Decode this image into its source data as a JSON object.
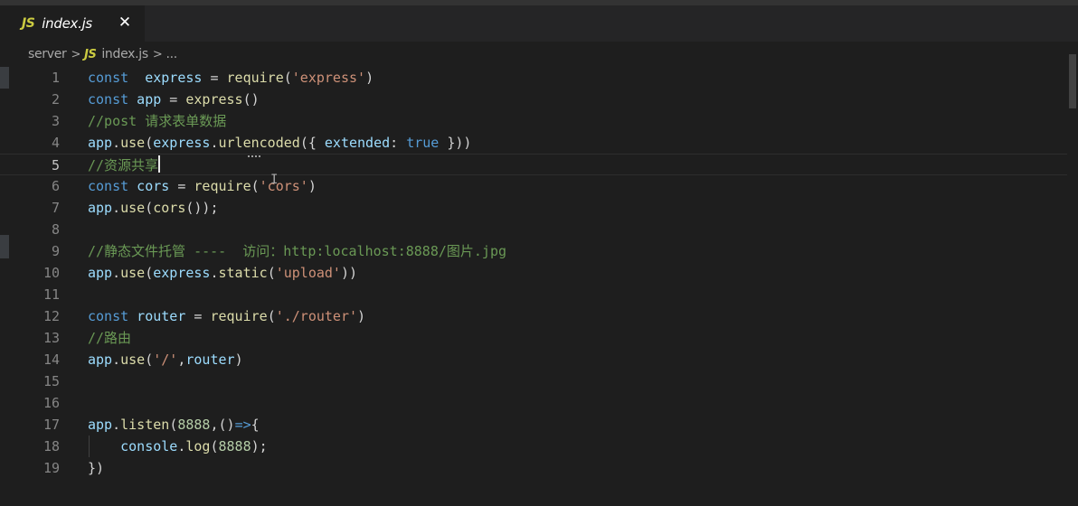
{
  "tab": {
    "language_badge": "JS",
    "filename": "index.js",
    "close_glyph": "✕"
  },
  "breadcrumb": {
    "folder": "server",
    "language_badge": "JS",
    "file": "index.js",
    "more": "..."
  },
  "editor": {
    "current_line": 5,
    "lines": [
      {
        "n": "1"
      },
      {
        "n": "2"
      },
      {
        "n": "3"
      },
      {
        "n": "4"
      },
      {
        "n": "5"
      },
      {
        "n": "6"
      },
      {
        "n": "7"
      },
      {
        "n": "8"
      },
      {
        "n": "9"
      },
      {
        "n": "10"
      },
      {
        "n": "11"
      },
      {
        "n": "12"
      },
      {
        "n": "13"
      },
      {
        "n": "14"
      },
      {
        "n": "15"
      },
      {
        "n": "16"
      },
      {
        "n": "17"
      },
      {
        "n": "18"
      },
      {
        "n": "19"
      }
    ],
    "tokens": {
      "l1": [
        "const",
        "  express",
        " = ",
        "require",
        "(",
        "'express'",
        ")"
      ],
      "l2": [
        "const",
        " app",
        " = ",
        "express",
        "()"
      ],
      "l3": [
        "//post 请求表单数据"
      ],
      "l4": [
        "app",
        ".",
        "use",
        "(",
        "express",
        ".",
        "urlencoded",
        "({ ",
        "extended",
        ": ",
        "true",
        " }))"
      ],
      "l5": [
        "//资源共享"
      ],
      "l6": [
        "const",
        " cors",
        " = ",
        "require",
        "(",
        "'cors'",
        ")"
      ],
      "l7": [
        "app",
        ".",
        "use",
        "(",
        "cors",
        "());"
      ],
      "l9": [
        "//静态文件托管 ----  访问：http:localhost:8888/图片.jpg"
      ],
      "l10": [
        "app",
        ".",
        "use",
        "(",
        "express",
        ".",
        "static",
        "(",
        "'upload'",
        "))"
      ],
      "l12": [
        "const",
        " router",
        " = ",
        "require",
        "(",
        "'./router'",
        ")"
      ],
      "l13": [
        "//路由"
      ],
      "l14": [
        "app",
        ".",
        "use",
        "(",
        "'/'",
        ",",
        "router",
        ")"
      ],
      "l17": [
        "app",
        ".",
        "listen",
        "(",
        "8888",
        ",",
        "()",
        "=>",
        "{"
      ],
      "l18": [
        "    ",
        "console",
        ".",
        "log",
        "(",
        "8888",
        ");"
      ],
      "l19": [
        "})"
      ]
    }
  },
  "colors": {
    "background": "#1e1e1e",
    "keyword": "#569cd6",
    "variable": "#9cdcfe",
    "function": "#dcdcaa",
    "string": "#ce9178",
    "comment": "#6a9955",
    "number": "#b5cea8",
    "js_badge": "#cbcb41"
  },
  "icons": {
    "tab_file_icon": "javascript-file-icon",
    "breadcrumb_file_icon": "javascript-file-icon",
    "close": "close-icon"
  }
}
